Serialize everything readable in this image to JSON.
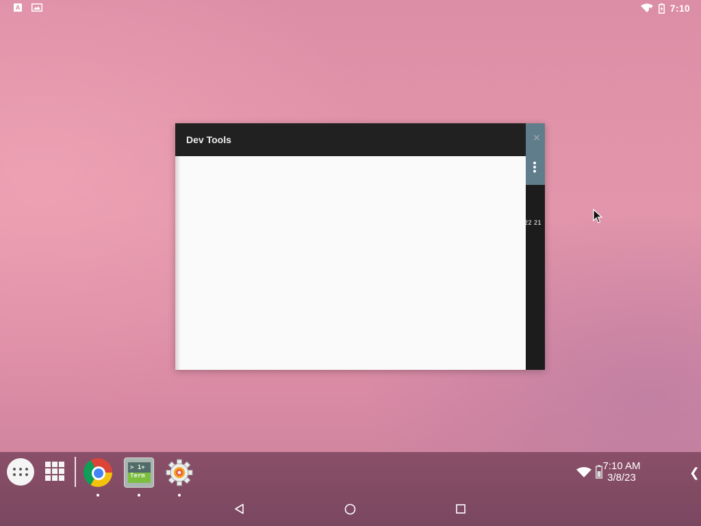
{
  "status_bar": {
    "notification_icons": [
      "text-a-icon",
      "image-icon"
    ],
    "notif_a_letter": "A",
    "time": "7:10",
    "right_icons": [
      "wifi-icon",
      "battery-icon"
    ]
  },
  "window": {
    "title": "Dev Tools",
    "side_numbers": "22  21"
  },
  "taskbar": {
    "pinned_apps": [
      "Chrome",
      "Terminal Emulator",
      "Settings"
    ],
    "terminal_icon_text": [
      "> 1+",
      "Term"
    ],
    "clock_time": "7:10 AM",
    "clock_date": "3/8/23"
  },
  "colors": {
    "titlebar": "#212121",
    "side_accent": "#607d8b",
    "taskbar": "#7a4760"
  }
}
